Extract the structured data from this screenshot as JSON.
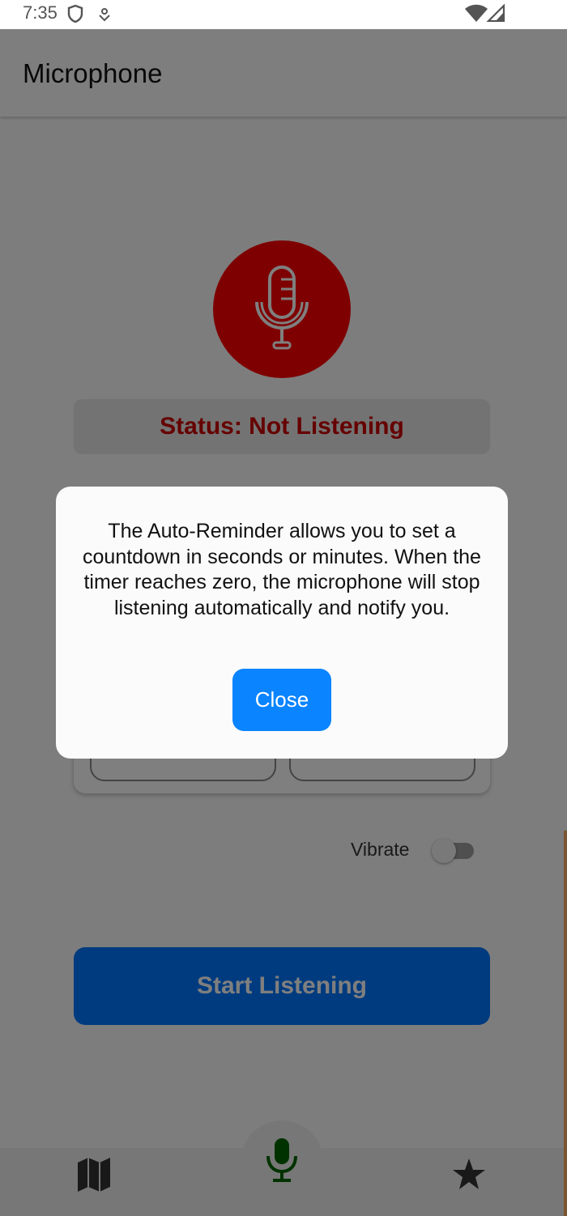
{
  "status_bar": {
    "time": "7:35",
    "icons": [
      "shield-icon",
      "data-saver-icon",
      "wifi-icon",
      "signal-icon"
    ]
  },
  "app_bar": {
    "title": "Microphone"
  },
  "main": {
    "mic_icon": "microphone-icon",
    "mic_circle_color": "#ff0000",
    "status_text": "Status: Not Listening",
    "status_color": "#cc0000",
    "vibrate_label": "Vibrate",
    "vibrate_on": false,
    "start_button_label": "Start Listening",
    "start_button_color": "#0077ff"
  },
  "dialog": {
    "message": "The Auto-Reminder allows you to set a countdown in seconds or minutes. When the timer reaches zero, the microphone will stop listening automatically and notify you.",
    "close_label": "Close",
    "close_color": "#0a84ff"
  },
  "bottom_nav": {
    "items": [
      {
        "icon": "map-icon",
        "active": false
      },
      {
        "icon": "microphone-icon",
        "active": true,
        "color": "#006400"
      },
      {
        "icon": "star-icon",
        "active": false
      }
    ]
  }
}
